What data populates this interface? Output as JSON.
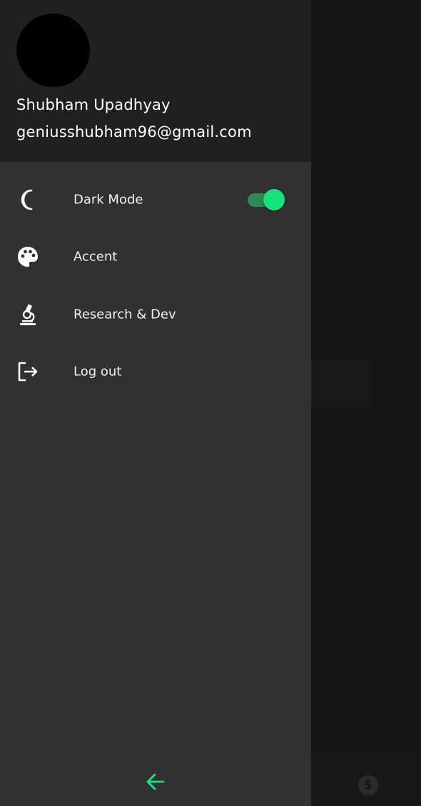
{
  "profile": {
    "name": "Shubham Upadhyay",
    "email": "geniusshubham96@gmail.com"
  },
  "menu": {
    "items": [
      {
        "label": "Dark Mode",
        "icon": "moon-icon"
      },
      {
        "label": "Accent",
        "icon": "palette-icon"
      },
      {
        "label": "Research & Dev",
        "icon": "microscope-icon"
      },
      {
        "label": "Log out",
        "icon": "logout-icon"
      }
    ],
    "dark_mode_enabled": true
  },
  "footer": {
    "back_icon": "arrow-left-icon"
  },
  "background": {
    "coin_glyph": "$"
  },
  "colors": {
    "accent": "#16e37a",
    "drawer": "#313131",
    "header": "#202020"
  }
}
